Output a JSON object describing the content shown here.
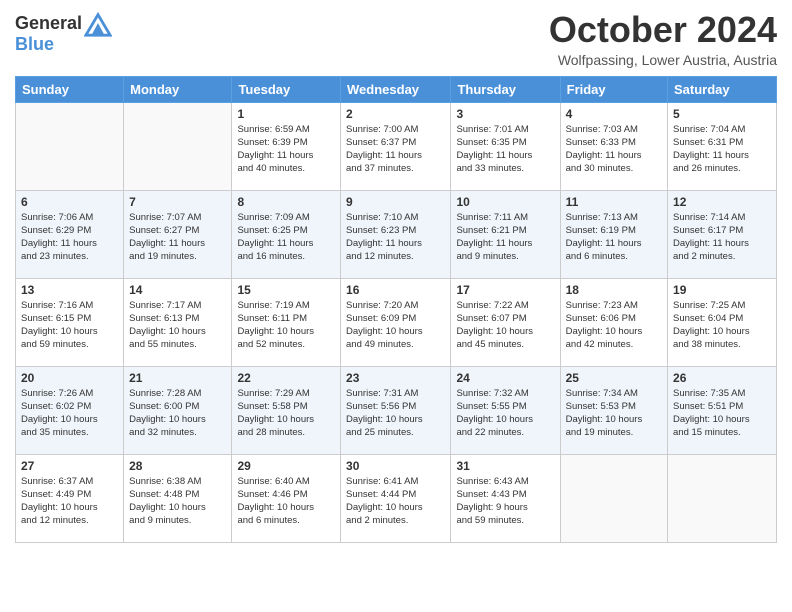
{
  "header": {
    "logo_line1": "General",
    "logo_line2": "Blue",
    "month": "October 2024",
    "location": "Wolfpassing, Lower Austria, Austria"
  },
  "days_of_week": [
    "Sunday",
    "Monday",
    "Tuesday",
    "Wednesday",
    "Thursday",
    "Friday",
    "Saturday"
  ],
  "weeks": [
    [
      {
        "day": "",
        "info": ""
      },
      {
        "day": "",
        "info": ""
      },
      {
        "day": "1",
        "info": "Sunrise: 6:59 AM\nSunset: 6:39 PM\nDaylight: 11 hours\nand 40 minutes."
      },
      {
        "day": "2",
        "info": "Sunrise: 7:00 AM\nSunset: 6:37 PM\nDaylight: 11 hours\nand 37 minutes."
      },
      {
        "day": "3",
        "info": "Sunrise: 7:01 AM\nSunset: 6:35 PM\nDaylight: 11 hours\nand 33 minutes."
      },
      {
        "day": "4",
        "info": "Sunrise: 7:03 AM\nSunset: 6:33 PM\nDaylight: 11 hours\nand 30 minutes."
      },
      {
        "day": "5",
        "info": "Sunrise: 7:04 AM\nSunset: 6:31 PM\nDaylight: 11 hours\nand 26 minutes."
      }
    ],
    [
      {
        "day": "6",
        "info": "Sunrise: 7:06 AM\nSunset: 6:29 PM\nDaylight: 11 hours\nand 23 minutes."
      },
      {
        "day": "7",
        "info": "Sunrise: 7:07 AM\nSunset: 6:27 PM\nDaylight: 11 hours\nand 19 minutes."
      },
      {
        "day": "8",
        "info": "Sunrise: 7:09 AM\nSunset: 6:25 PM\nDaylight: 11 hours\nand 16 minutes."
      },
      {
        "day": "9",
        "info": "Sunrise: 7:10 AM\nSunset: 6:23 PM\nDaylight: 11 hours\nand 12 minutes."
      },
      {
        "day": "10",
        "info": "Sunrise: 7:11 AM\nSunset: 6:21 PM\nDaylight: 11 hours\nand 9 minutes."
      },
      {
        "day": "11",
        "info": "Sunrise: 7:13 AM\nSunset: 6:19 PM\nDaylight: 11 hours\nand 6 minutes."
      },
      {
        "day": "12",
        "info": "Sunrise: 7:14 AM\nSunset: 6:17 PM\nDaylight: 11 hours\nand 2 minutes."
      }
    ],
    [
      {
        "day": "13",
        "info": "Sunrise: 7:16 AM\nSunset: 6:15 PM\nDaylight: 10 hours\nand 59 minutes."
      },
      {
        "day": "14",
        "info": "Sunrise: 7:17 AM\nSunset: 6:13 PM\nDaylight: 10 hours\nand 55 minutes."
      },
      {
        "day": "15",
        "info": "Sunrise: 7:19 AM\nSunset: 6:11 PM\nDaylight: 10 hours\nand 52 minutes."
      },
      {
        "day": "16",
        "info": "Sunrise: 7:20 AM\nSunset: 6:09 PM\nDaylight: 10 hours\nand 49 minutes."
      },
      {
        "day": "17",
        "info": "Sunrise: 7:22 AM\nSunset: 6:07 PM\nDaylight: 10 hours\nand 45 minutes."
      },
      {
        "day": "18",
        "info": "Sunrise: 7:23 AM\nSunset: 6:06 PM\nDaylight: 10 hours\nand 42 minutes."
      },
      {
        "day": "19",
        "info": "Sunrise: 7:25 AM\nSunset: 6:04 PM\nDaylight: 10 hours\nand 38 minutes."
      }
    ],
    [
      {
        "day": "20",
        "info": "Sunrise: 7:26 AM\nSunset: 6:02 PM\nDaylight: 10 hours\nand 35 minutes."
      },
      {
        "day": "21",
        "info": "Sunrise: 7:28 AM\nSunset: 6:00 PM\nDaylight: 10 hours\nand 32 minutes."
      },
      {
        "day": "22",
        "info": "Sunrise: 7:29 AM\nSunset: 5:58 PM\nDaylight: 10 hours\nand 28 minutes."
      },
      {
        "day": "23",
        "info": "Sunrise: 7:31 AM\nSunset: 5:56 PM\nDaylight: 10 hours\nand 25 minutes."
      },
      {
        "day": "24",
        "info": "Sunrise: 7:32 AM\nSunset: 5:55 PM\nDaylight: 10 hours\nand 22 minutes."
      },
      {
        "day": "25",
        "info": "Sunrise: 7:34 AM\nSunset: 5:53 PM\nDaylight: 10 hours\nand 19 minutes."
      },
      {
        "day": "26",
        "info": "Sunrise: 7:35 AM\nSunset: 5:51 PM\nDaylight: 10 hours\nand 15 minutes."
      }
    ],
    [
      {
        "day": "27",
        "info": "Sunrise: 6:37 AM\nSunset: 4:49 PM\nDaylight: 10 hours\nand 12 minutes."
      },
      {
        "day": "28",
        "info": "Sunrise: 6:38 AM\nSunset: 4:48 PM\nDaylight: 10 hours\nand 9 minutes."
      },
      {
        "day": "29",
        "info": "Sunrise: 6:40 AM\nSunset: 4:46 PM\nDaylight: 10 hours\nand 6 minutes."
      },
      {
        "day": "30",
        "info": "Sunrise: 6:41 AM\nSunset: 4:44 PM\nDaylight: 10 hours\nand 2 minutes."
      },
      {
        "day": "31",
        "info": "Sunrise: 6:43 AM\nSunset: 4:43 PM\nDaylight: 9 hours\nand 59 minutes."
      },
      {
        "day": "",
        "info": ""
      },
      {
        "day": "",
        "info": ""
      }
    ]
  ]
}
